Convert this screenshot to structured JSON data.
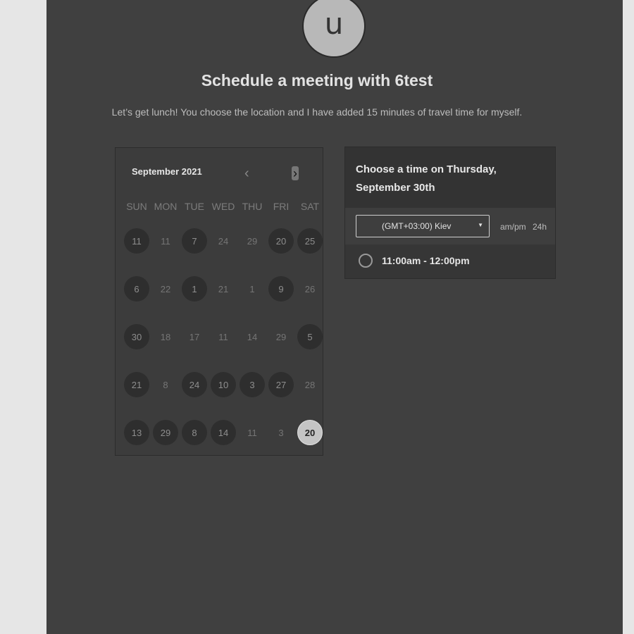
{
  "host": {
    "avatar_letter": "u",
    "title": "Schedule a meeting with 6test",
    "description": "Let’s get lunch! You choose the location and I have added 15 minutes of travel time for myself."
  },
  "calendar": {
    "month_label": "September 2021",
    "prev_icon": "chevron-left-icon",
    "next_icon": "chevron-right-icon",
    "prev_glyph": "‹",
    "next_glyph": "›",
    "weekdays": [
      "SUN",
      "MON",
      "TUE",
      "WED",
      "THU",
      "FRI",
      "SAT"
    ],
    "weeks": [
      [
        {
          "label": "11",
          "available": true
        },
        {
          "label": "11",
          "available": false
        },
        {
          "label": "7",
          "available": true
        },
        {
          "label": "24",
          "available": false
        },
        {
          "label": "29",
          "available": false
        },
        {
          "label": "20",
          "available": true
        },
        {
          "label": "25",
          "available": true
        }
      ],
      [
        {
          "label": "6",
          "available": true
        },
        {
          "label": "22",
          "available": false
        },
        {
          "label": "1",
          "available": true
        },
        {
          "label": "21",
          "available": false
        },
        {
          "label": "1",
          "available": false
        },
        {
          "label": "9",
          "available": true
        },
        {
          "label": "26",
          "available": false
        }
      ],
      [
        {
          "label": "30",
          "available": true
        },
        {
          "label": "18",
          "available": false
        },
        {
          "label": "17",
          "available": false
        },
        {
          "label": "11",
          "available": false
        },
        {
          "label": "14",
          "available": false
        },
        {
          "label": "29",
          "available": false
        },
        {
          "label": "5",
          "available": true
        }
      ],
      [
        {
          "label": "21",
          "available": true
        },
        {
          "label": "8",
          "available": false
        },
        {
          "label": "24",
          "available": true
        },
        {
          "label": "10",
          "available": true
        },
        {
          "label": "3",
          "available": true
        },
        {
          "label": "27",
          "available": true
        },
        {
          "label": "28",
          "available": false
        }
      ],
      [
        {
          "label": "13",
          "available": true
        },
        {
          "label": "29",
          "available": true
        },
        {
          "label": "8",
          "available": true
        },
        {
          "label": "14",
          "available": true
        },
        {
          "label": "11",
          "available": false
        },
        {
          "label": "3",
          "available": false
        },
        {
          "label": "20",
          "available": true,
          "selected": true
        }
      ]
    ]
  },
  "time_picker": {
    "heading": "Choose a time on Thursday, September 30th",
    "timezone": "(GMT+03:00) Kiev",
    "caret_icon": "caret-down-icon",
    "caret_glyph": "▼",
    "format_ampm": "am/pm",
    "format_24h": "24h",
    "slots": [
      "11:00am - 12:00pm"
    ]
  },
  "colors": {
    "page_bg": "#e6e6e6",
    "panel_bg": "#404040",
    "selected_day": "#c4c4c4"
  }
}
